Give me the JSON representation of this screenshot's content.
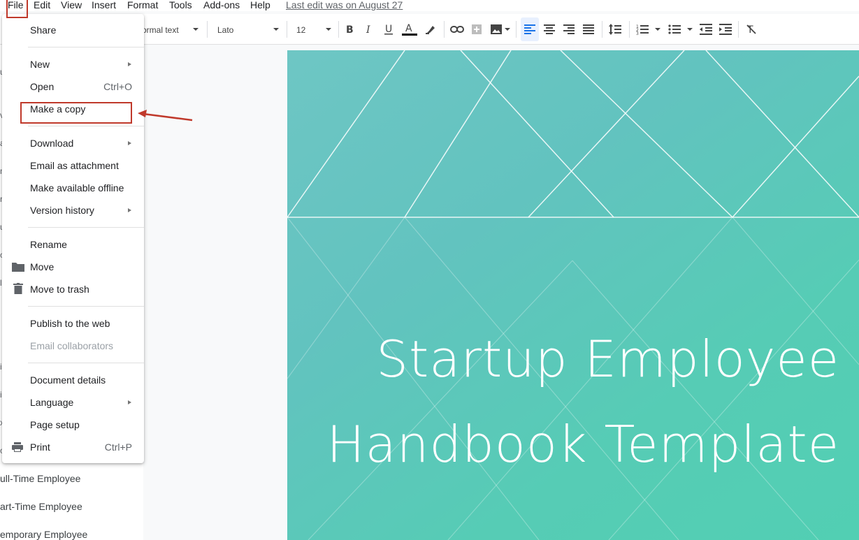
{
  "menubar": {
    "items": [
      "File",
      "Edit",
      "View",
      "Insert",
      "Format",
      "Tools",
      "Add-ons",
      "Help"
    ],
    "last_edit": "Last edit was on August 27"
  },
  "toolbar": {
    "style_label": "ormal text",
    "font_label": "Lato",
    "size_label": "12",
    "icons": [
      "bold-icon",
      "italic-icon",
      "underline-icon",
      "text-color-icon",
      "highlight-icon",
      "link-icon",
      "comment-icon",
      "image-icon",
      "align-left-icon",
      "align-center-icon",
      "align-right-icon",
      "justify-icon",
      "line-spacing-icon",
      "numbered-list-icon",
      "bulleted-list-icon",
      "decrease-indent-icon",
      "increase-indent-icon",
      "clear-formatting-icon"
    ]
  },
  "file_menu": {
    "share": "Share",
    "new": "New",
    "open": "Open",
    "open_shortcut": "Ctrl+O",
    "make_copy": "Make a copy",
    "download": "Download",
    "email_attachment": "Email as attachment",
    "offline": "Make available offline",
    "version_history": "Version history",
    "rename": "Rename",
    "move": "Move",
    "trash": "Move to trash",
    "publish": "Publish to the web",
    "email_collab": "Email collaborators",
    "details": "Document details",
    "language": "Language",
    "page_setup": "Page setup",
    "print": "Print",
    "print_shortcut": "Ctrl+P"
  },
  "outline": {
    "items": [
      "ull-Time Employee",
      "art-Time Employee",
      "emporary Employee"
    ],
    "edge_glyphs": [
      "u",
      "v",
      "a",
      "n",
      "r",
      "u",
      "c",
      "l",
      "i",
      "i",
      "x",
      "c"
    ]
  },
  "document": {
    "title_line1": "Startup Employee",
    "title_line2": "Handbook Template"
  },
  "colors": {
    "highlight_box": "#c0392b",
    "page_teal": "#5ec8bb",
    "active_align": "#e8f0fe"
  }
}
